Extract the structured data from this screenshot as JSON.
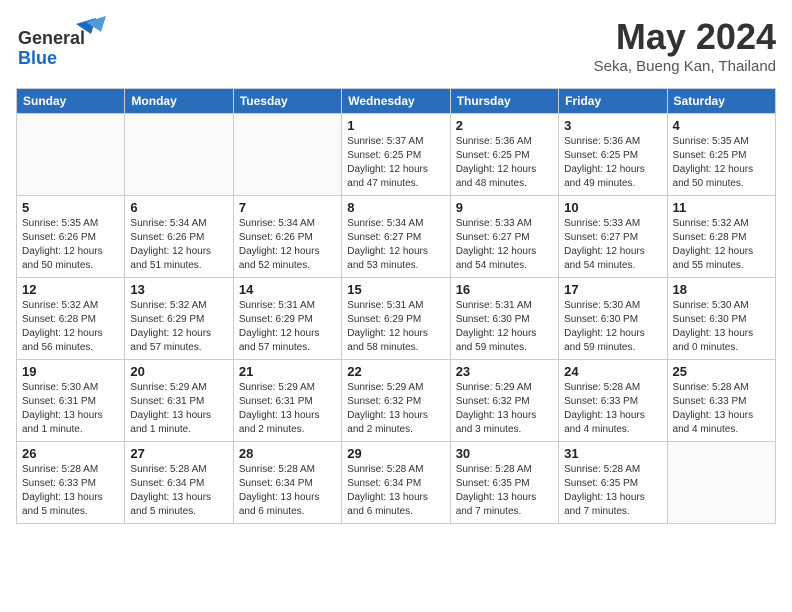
{
  "header": {
    "logo_line1": "General",
    "logo_line2": "Blue",
    "month_title": "May 2024",
    "subtitle": "Seka, Bueng Kan, Thailand"
  },
  "days_of_week": [
    "Sunday",
    "Monday",
    "Tuesday",
    "Wednesday",
    "Thursday",
    "Friday",
    "Saturday"
  ],
  "weeks": [
    [
      {
        "day": "",
        "info": ""
      },
      {
        "day": "",
        "info": ""
      },
      {
        "day": "",
        "info": ""
      },
      {
        "day": "1",
        "info": "Sunrise: 5:37 AM\nSunset: 6:25 PM\nDaylight: 12 hours\nand 47 minutes."
      },
      {
        "day": "2",
        "info": "Sunrise: 5:36 AM\nSunset: 6:25 PM\nDaylight: 12 hours\nand 48 minutes."
      },
      {
        "day": "3",
        "info": "Sunrise: 5:36 AM\nSunset: 6:25 PM\nDaylight: 12 hours\nand 49 minutes."
      },
      {
        "day": "4",
        "info": "Sunrise: 5:35 AM\nSunset: 6:25 PM\nDaylight: 12 hours\nand 50 minutes."
      }
    ],
    [
      {
        "day": "5",
        "info": "Sunrise: 5:35 AM\nSunset: 6:26 PM\nDaylight: 12 hours\nand 50 minutes."
      },
      {
        "day": "6",
        "info": "Sunrise: 5:34 AM\nSunset: 6:26 PM\nDaylight: 12 hours\nand 51 minutes."
      },
      {
        "day": "7",
        "info": "Sunrise: 5:34 AM\nSunset: 6:26 PM\nDaylight: 12 hours\nand 52 minutes."
      },
      {
        "day": "8",
        "info": "Sunrise: 5:34 AM\nSunset: 6:27 PM\nDaylight: 12 hours\nand 53 minutes."
      },
      {
        "day": "9",
        "info": "Sunrise: 5:33 AM\nSunset: 6:27 PM\nDaylight: 12 hours\nand 54 minutes."
      },
      {
        "day": "10",
        "info": "Sunrise: 5:33 AM\nSunset: 6:27 PM\nDaylight: 12 hours\nand 54 minutes."
      },
      {
        "day": "11",
        "info": "Sunrise: 5:32 AM\nSunset: 6:28 PM\nDaylight: 12 hours\nand 55 minutes."
      }
    ],
    [
      {
        "day": "12",
        "info": "Sunrise: 5:32 AM\nSunset: 6:28 PM\nDaylight: 12 hours\nand 56 minutes."
      },
      {
        "day": "13",
        "info": "Sunrise: 5:32 AM\nSunset: 6:29 PM\nDaylight: 12 hours\nand 57 minutes."
      },
      {
        "day": "14",
        "info": "Sunrise: 5:31 AM\nSunset: 6:29 PM\nDaylight: 12 hours\nand 57 minutes."
      },
      {
        "day": "15",
        "info": "Sunrise: 5:31 AM\nSunset: 6:29 PM\nDaylight: 12 hours\nand 58 minutes."
      },
      {
        "day": "16",
        "info": "Sunrise: 5:31 AM\nSunset: 6:30 PM\nDaylight: 12 hours\nand 59 minutes."
      },
      {
        "day": "17",
        "info": "Sunrise: 5:30 AM\nSunset: 6:30 PM\nDaylight: 12 hours\nand 59 minutes."
      },
      {
        "day": "18",
        "info": "Sunrise: 5:30 AM\nSunset: 6:30 PM\nDaylight: 13 hours\nand 0 minutes."
      }
    ],
    [
      {
        "day": "19",
        "info": "Sunrise: 5:30 AM\nSunset: 6:31 PM\nDaylight: 13 hours\nand 1 minute."
      },
      {
        "day": "20",
        "info": "Sunrise: 5:29 AM\nSunset: 6:31 PM\nDaylight: 13 hours\nand 1 minute."
      },
      {
        "day": "21",
        "info": "Sunrise: 5:29 AM\nSunset: 6:31 PM\nDaylight: 13 hours\nand 2 minutes."
      },
      {
        "day": "22",
        "info": "Sunrise: 5:29 AM\nSunset: 6:32 PM\nDaylight: 13 hours\nand 2 minutes."
      },
      {
        "day": "23",
        "info": "Sunrise: 5:29 AM\nSunset: 6:32 PM\nDaylight: 13 hours\nand 3 minutes."
      },
      {
        "day": "24",
        "info": "Sunrise: 5:28 AM\nSunset: 6:33 PM\nDaylight: 13 hours\nand 4 minutes."
      },
      {
        "day": "25",
        "info": "Sunrise: 5:28 AM\nSunset: 6:33 PM\nDaylight: 13 hours\nand 4 minutes."
      }
    ],
    [
      {
        "day": "26",
        "info": "Sunrise: 5:28 AM\nSunset: 6:33 PM\nDaylight: 13 hours\nand 5 minutes."
      },
      {
        "day": "27",
        "info": "Sunrise: 5:28 AM\nSunset: 6:34 PM\nDaylight: 13 hours\nand 5 minutes."
      },
      {
        "day": "28",
        "info": "Sunrise: 5:28 AM\nSunset: 6:34 PM\nDaylight: 13 hours\nand 6 minutes."
      },
      {
        "day": "29",
        "info": "Sunrise: 5:28 AM\nSunset: 6:34 PM\nDaylight: 13 hours\nand 6 minutes."
      },
      {
        "day": "30",
        "info": "Sunrise: 5:28 AM\nSunset: 6:35 PM\nDaylight: 13 hours\nand 7 minutes."
      },
      {
        "day": "31",
        "info": "Sunrise: 5:28 AM\nSunset: 6:35 PM\nDaylight: 13 hours\nand 7 minutes."
      },
      {
        "day": "",
        "info": ""
      }
    ]
  ]
}
